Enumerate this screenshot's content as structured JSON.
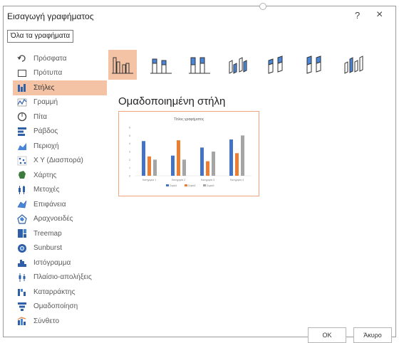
{
  "dialog": {
    "title": "Εισαγωγή γραφήματος",
    "help": "?",
    "close": "×",
    "tab_label": "Όλα τα γραφήματα"
  },
  "sidebar": {
    "items": [
      {
        "label": "Πρόσφατα",
        "icon": "recent-icon"
      },
      {
        "label": "Πρότυπα",
        "icon": "templates-icon"
      },
      {
        "label": "Στήλες",
        "icon": "column-chart-icon",
        "selected": true
      },
      {
        "label": "Γραμμή",
        "icon": "line-chart-icon"
      },
      {
        "label": "Πίτα",
        "icon": "pie-chart-icon"
      },
      {
        "label": "Ράβδος",
        "icon": "bar-chart-icon"
      },
      {
        "label": "Περιοχή",
        "icon": "area-chart-icon"
      },
      {
        "label": "Χ Υ (Διασπορά)",
        "icon": "scatter-chart-icon"
      },
      {
        "label": "Χάρτης",
        "icon": "map-chart-icon"
      },
      {
        "label": "Μετοχές",
        "icon": "stock-chart-icon"
      },
      {
        "label": "Επιφάνεια",
        "icon": "surface-chart-icon"
      },
      {
        "label": "Αραχνοειδές",
        "icon": "radar-chart-icon"
      },
      {
        "label": "Treemap",
        "icon": "treemap-icon"
      },
      {
        "label": "Sunburst",
        "icon": "sunburst-icon"
      },
      {
        "label": "Ιστόγραμμα",
        "icon": "histogram-icon"
      },
      {
        "label": "Πλαίσιο-απολήξεις",
        "icon": "box-whisker-icon"
      },
      {
        "label": "Καταρράκτης",
        "icon": "waterfall-icon"
      },
      {
        "label": "Ομαδοποίηση",
        "icon": "funnel-icon"
      },
      {
        "label": "Σύνθετο",
        "icon": "combo-chart-icon"
      }
    ]
  },
  "subtypes": [
    {
      "name": "clustered-column-icon",
      "selected": true
    },
    {
      "name": "stacked-column-icon"
    },
    {
      "name": "100-stacked-column-icon"
    },
    {
      "name": "3d-clustered-column-icon"
    },
    {
      "name": "3d-stacked-column-icon"
    },
    {
      "name": "3d-100-stacked-column-icon"
    },
    {
      "name": "3d-column-icon"
    }
  ],
  "selected_subtype_label": "Ομαδοποιημένη στήλη",
  "colors": {
    "accent": "#f4c3a5",
    "series1": "#4472c4",
    "series2": "#ed7d31",
    "series3": "#a5a5a5"
  },
  "chart_data": {
    "type": "bar",
    "title": "Τίτλος γραφήματος",
    "categories": [
      "Κατηγορία 1",
      "Κατηγορία 2",
      "Κατηγορία 3",
      "Κατηγορία 4"
    ],
    "series": [
      {
        "name": "Σειρά1",
        "values": [
          4.3,
          2.5,
          3.5,
          4.5
        ]
      },
      {
        "name": "Σειρά2",
        "values": [
          2.4,
          4.4,
          1.8,
          2.8
        ]
      },
      {
        "name": "Σειρά3",
        "values": [
          2.0,
          2.0,
          3.0,
          5.0
        ]
      }
    ],
    "ylim": [
      0,
      6
    ],
    "yticks": [
      0,
      1,
      2,
      3,
      4,
      5,
      6
    ],
    "legend": "bottom",
    "grid": false
  },
  "buttons": {
    "ok": "OK",
    "cancel": "Άκυρο"
  }
}
